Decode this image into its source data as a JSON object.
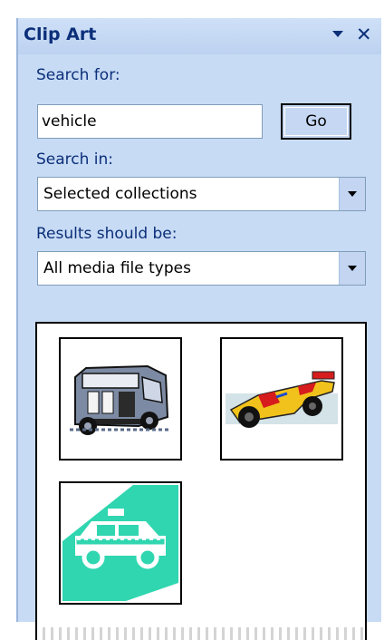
{
  "pane": {
    "title": "Clip Art",
    "menu_icon": "dropdown-arrow-icon",
    "close_icon": "close-icon",
    "close_glyph": "✕"
  },
  "search": {
    "label": "Search for:",
    "value": "vehicle",
    "go_label": "Go"
  },
  "search_in": {
    "label": "Search in:",
    "selected": "Selected collections"
  },
  "results_type": {
    "label": "Results should be:",
    "selected": "All media file types"
  },
  "results": {
    "items": [
      {
        "name": "ambulance-clipart",
        "icon": "ambulance-icon"
      },
      {
        "name": "race-car-clipart",
        "icon": "race-car-icon"
      },
      {
        "name": "taxi-clipart",
        "icon": "taxi-icon"
      }
    ]
  },
  "colors": {
    "pane_bg": "#c8dbf5",
    "title_text": "#0b2f79",
    "taxi_teal": "#2fd6b0"
  }
}
